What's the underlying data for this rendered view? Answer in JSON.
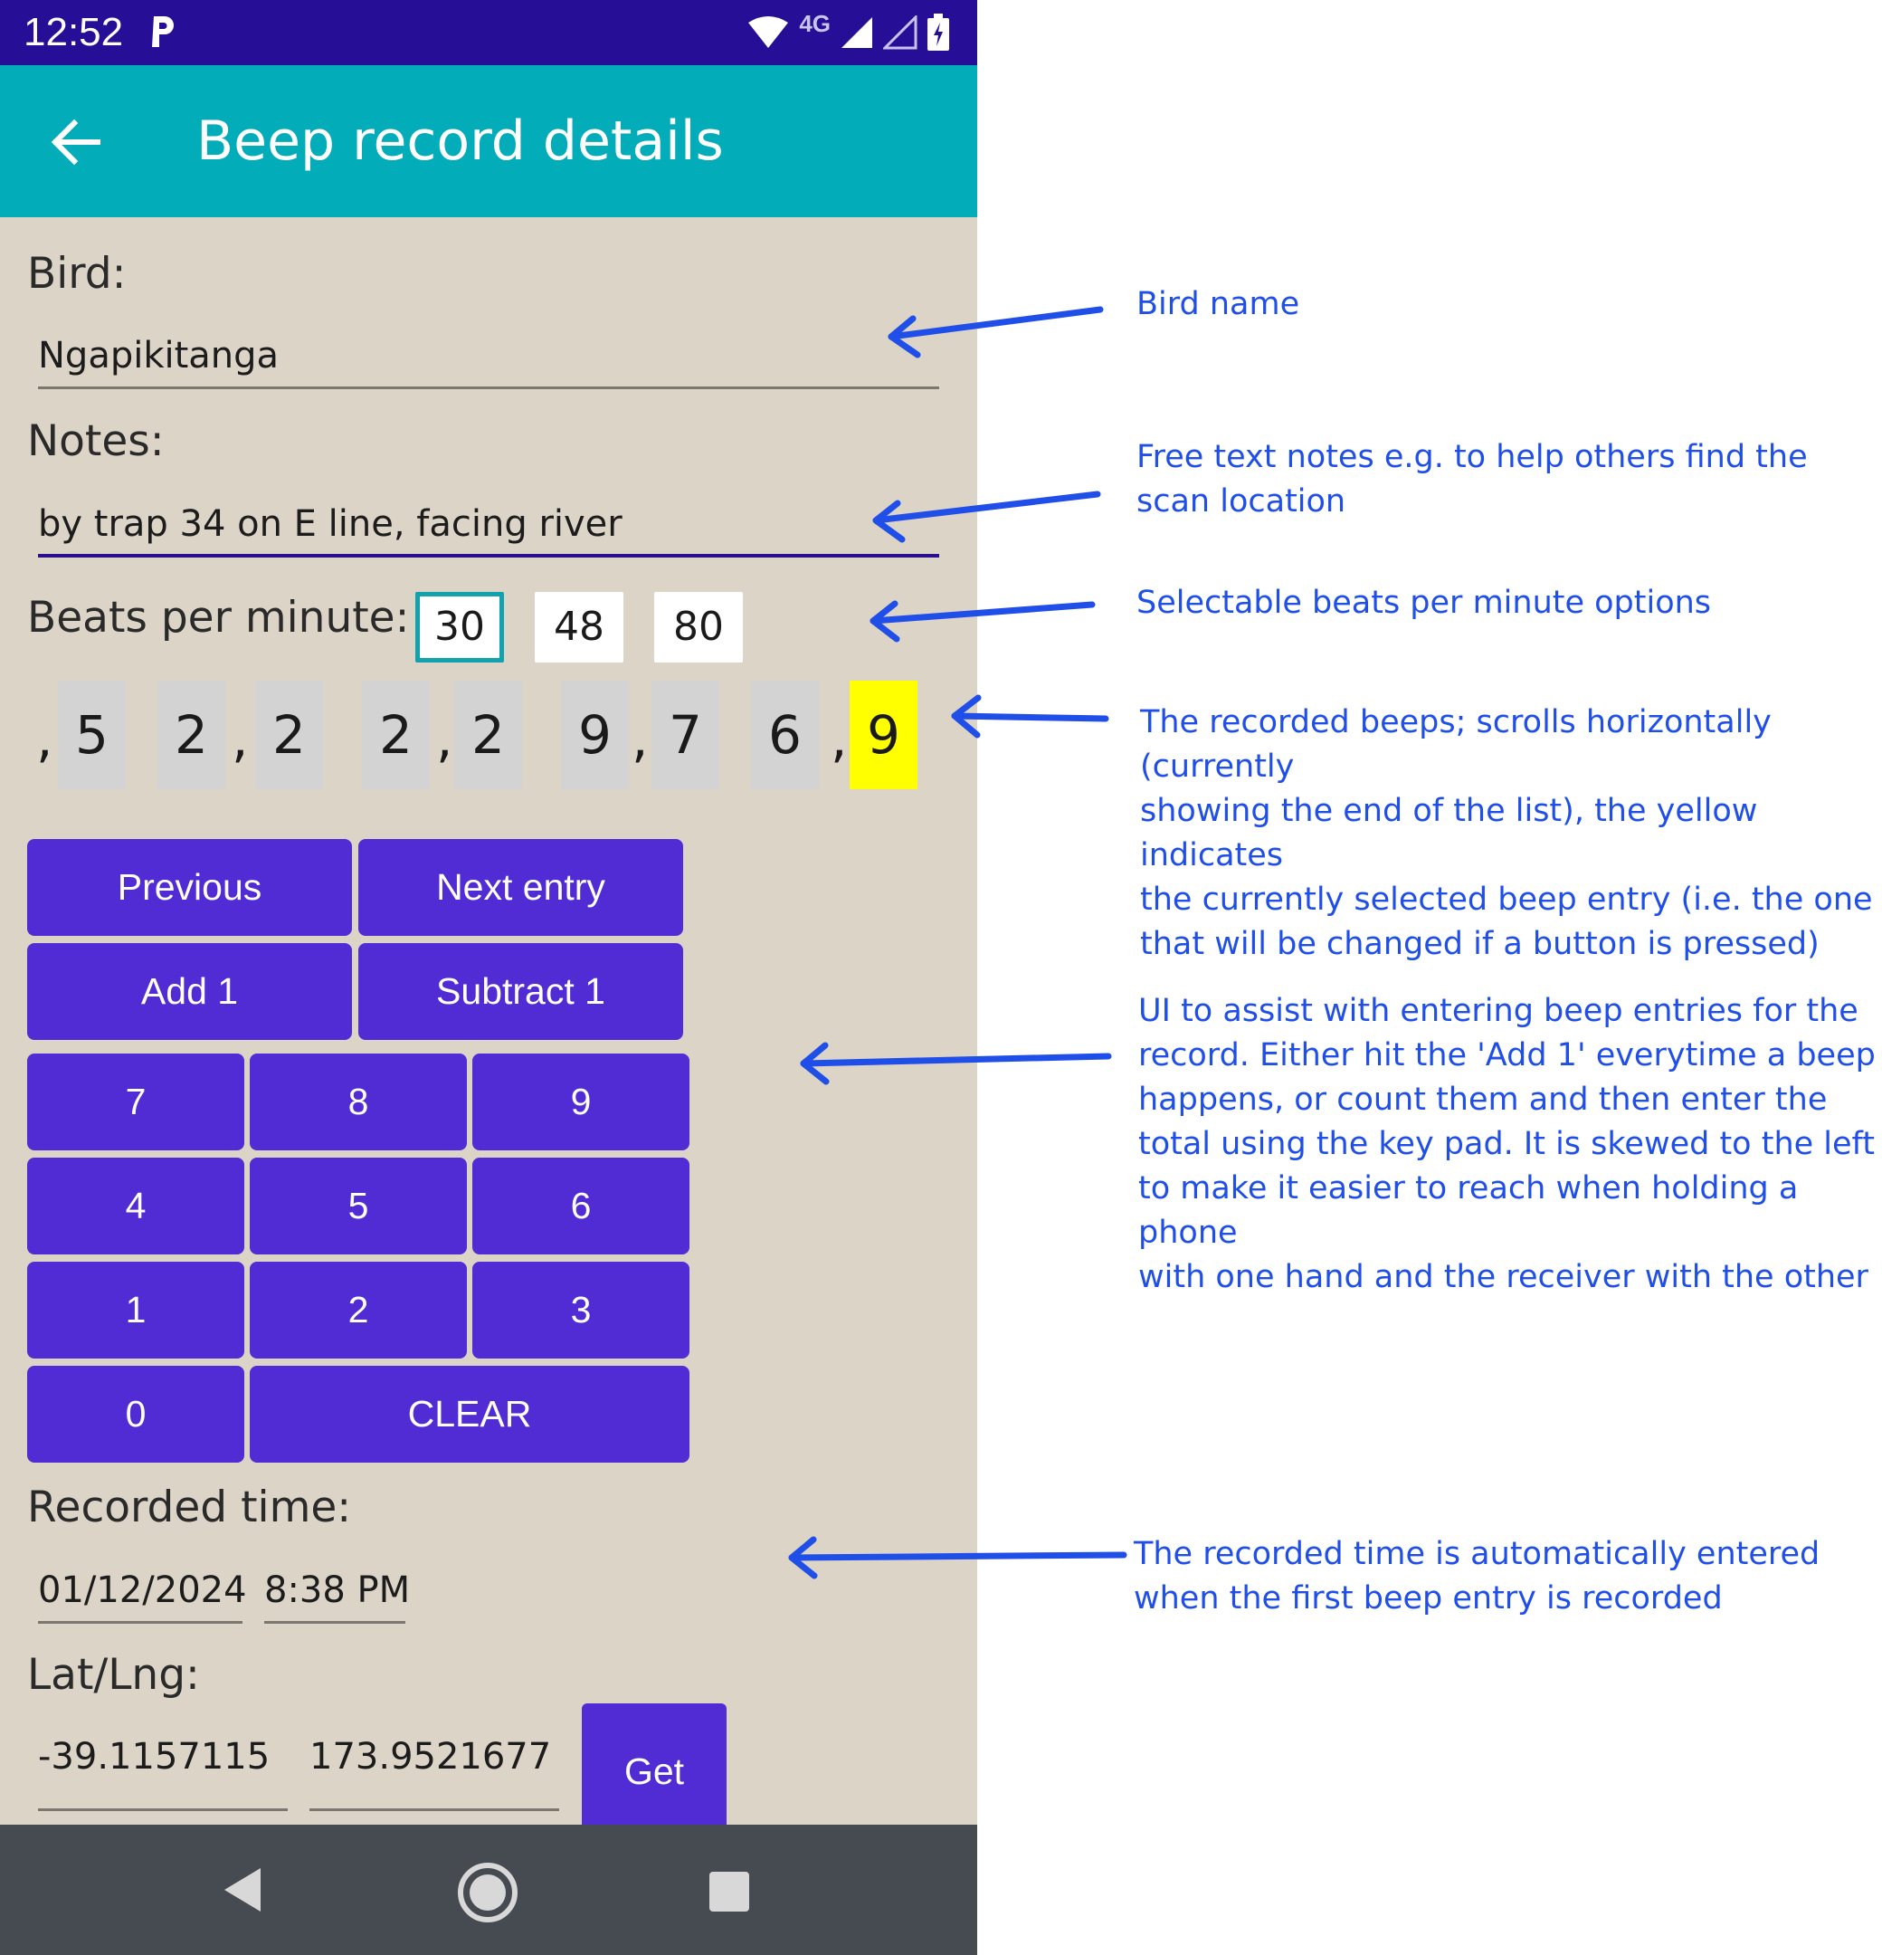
{
  "status_bar": {
    "time": "12:52",
    "network": "4G"
  },
  "app_bar": {
    "title": "Beep record details",
    "back_icon": "arrow-left-icon"
  },
  "form": {
    "bird_label": "Bird:",
    "bird_value": "Ngapikitanga",
    "notes_label": "Notes:",
    "notes_value": "by trap 34 on E line, facing river",
    "bpm_label": "Beats per minute:",
    "bpm_options": [
      "30",
      "48",
      "80"
    ],
    "bpm_selected": "30",
    "beeps": {
      "separators": [
        ",",
        ",",
        ",",
        ",",
        ","
      ],
      "digits": [
        "5",
        "2",
        "2",
        "2",
        "2",
        "9",
        "7",
        "6",
        "9"
      ],
      "selected_index": 8
    },
    "recorded_time_label": "Recorded time:",
    "recorded_date": "01/12/2024",
    "recorded_time": "8:38 PM",
    "latlng_label": "Lat/Lng:",
    "lat": "-39.1157115",
    "lng": "173.9521677"
  },
  "buttons": {
    "previous": "Previous",
    "next_entry": "Next entry",
    "add_1": "Add 1",
    "subtract_1": "Subtract 1",
    "keypad": [
      "7",
      "8",
      "9",
      "4",
      "5",
      "6",
      "1",
      "2",
      "3",
      "0"
    ],
    "clear": "CLEAR",
    "get": "Get"
  },
  "annotations": {
    "bird_name": "Bird name",
    "notes": [
      "Free text notes e.g. to help others find the",
      "scan location"
    ],
    "bpm": "Selectable beats per minute options",
    "beeps": [
      "The recorded beeps; scrolls horizontally (currently",
      "showing the end of the list), the yellow indicates",
      "the currently selected beep entry (i.e. the one",
      "that will be changed if a button is pressed)"
    ],
    "ui": [
      "UI to assist with entering beep entries for the",
      "record. Either hit the 'Add 1' everytime a beep",
      "happens, or count them and then enter the",
      "total using the key pad. It is skewed to the left",
      "to make it easier to reach when holding a phone",
      "with one hand and the receiver with the other"
    ],
    "time": [
      "The recorded time is automatically entered",
      "when the first beep entry is recorded"
    ]
  },
  "colors": {
    "status_bar": "#260e96",
    "app_bar": "#02acb9",
    "background": "#dbd4c7",
    "button": "#512bd4",
    "selected_beep": "#ffff00",
    "annotation": "#1f4fe8",
    "nav_bar": "#464a51"
  }
}
